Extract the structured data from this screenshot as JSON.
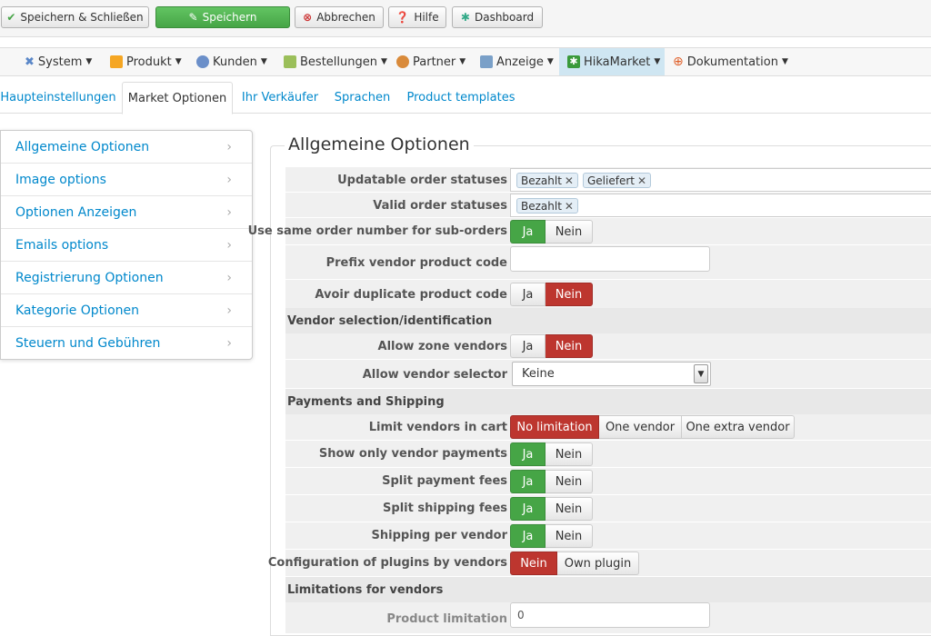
{
  "toolbar": {
    "save_close": "Speichern & Schließen",
    "save": "Speichern",
    "cancel": "Abbrechen",
    "help": "Hilfe",
    "dashboard": "Dashboard"
  },
  "menu": {
    "system": "System",
    "produkt": "Produkt",
    "kunden": "Kunden",
    "bestellungen": "Bestellungen",
    "partner": "Partner",
    "anzeige": "Anzeige",
    "hikamarket": "HikaMarket",
    "dokumentation": "Dokumentation"
  },
  "tabs": {
    "haupt": "Haupteinstellungen",
    "market": "Market Optionen",
    "verkaeufer": "Ihr Verkäufer",
    "sprachen": "Sprachen",
    "templates": "Product templates"
  },
  "sidebar": {
    "items": [
      "Allgemeine Optionen",
      "Image options",
      "Optionen Anzeigen",
      "Emails options",
      "Registrierung Optionen",
      "Kategorie Optionen",
      "Steuern und Gebühren"
    ]
  },
  "form": {
    "legend": "Allgemeine Optionen",
    "updatable_label": "Updatable order statuses",
    "updatable_tags": [
      "Bezahlt",
      "Geliefert"
    ],
    "valid_label": "Valid order statuses",
    "valid_tags": [
      "Bezahlt"
    ],
    "same_number_label": "Use same order number for sub-orders",
    "prefix_label": "Prefix vendor product code",
    "prefix_value": "",
    "avoid_dup_label": "Avoir duplicate product code",
    "section_vendor": "Vendor selection/identification",
    "zone_vendors_label": "Allow zone vendors",
    "vendor_selector_label": "Allow vendor selector",
    "vendor_selector_value": "Keine",
    "section_payments": "Payments and Shipping",
    "limit_vendors_label": "Limit vendors in cart",
    "limit_no": "No limitation",
    "limit_one": "One vendor",
    "limit_extra": "One extra vendor",
    "vendor_payments_label": "Show only vendor payments",
    "split_payment_label": "Split payment fees",
    "split_shipping_label": "Split shipping fees",
    "shipping_vendor_label": "Shipping per vendor",
    "plugins_label": "Configuration of plugins by vendors",
    "own_plugin": "Own plugin",
    "section_limits": "Limitations for vendors",
    "product_limit_label": "Product limitation",
    "product_limit_value": "0",
    "ja": "Ja",
    "nein": "Nein"
  }
}
